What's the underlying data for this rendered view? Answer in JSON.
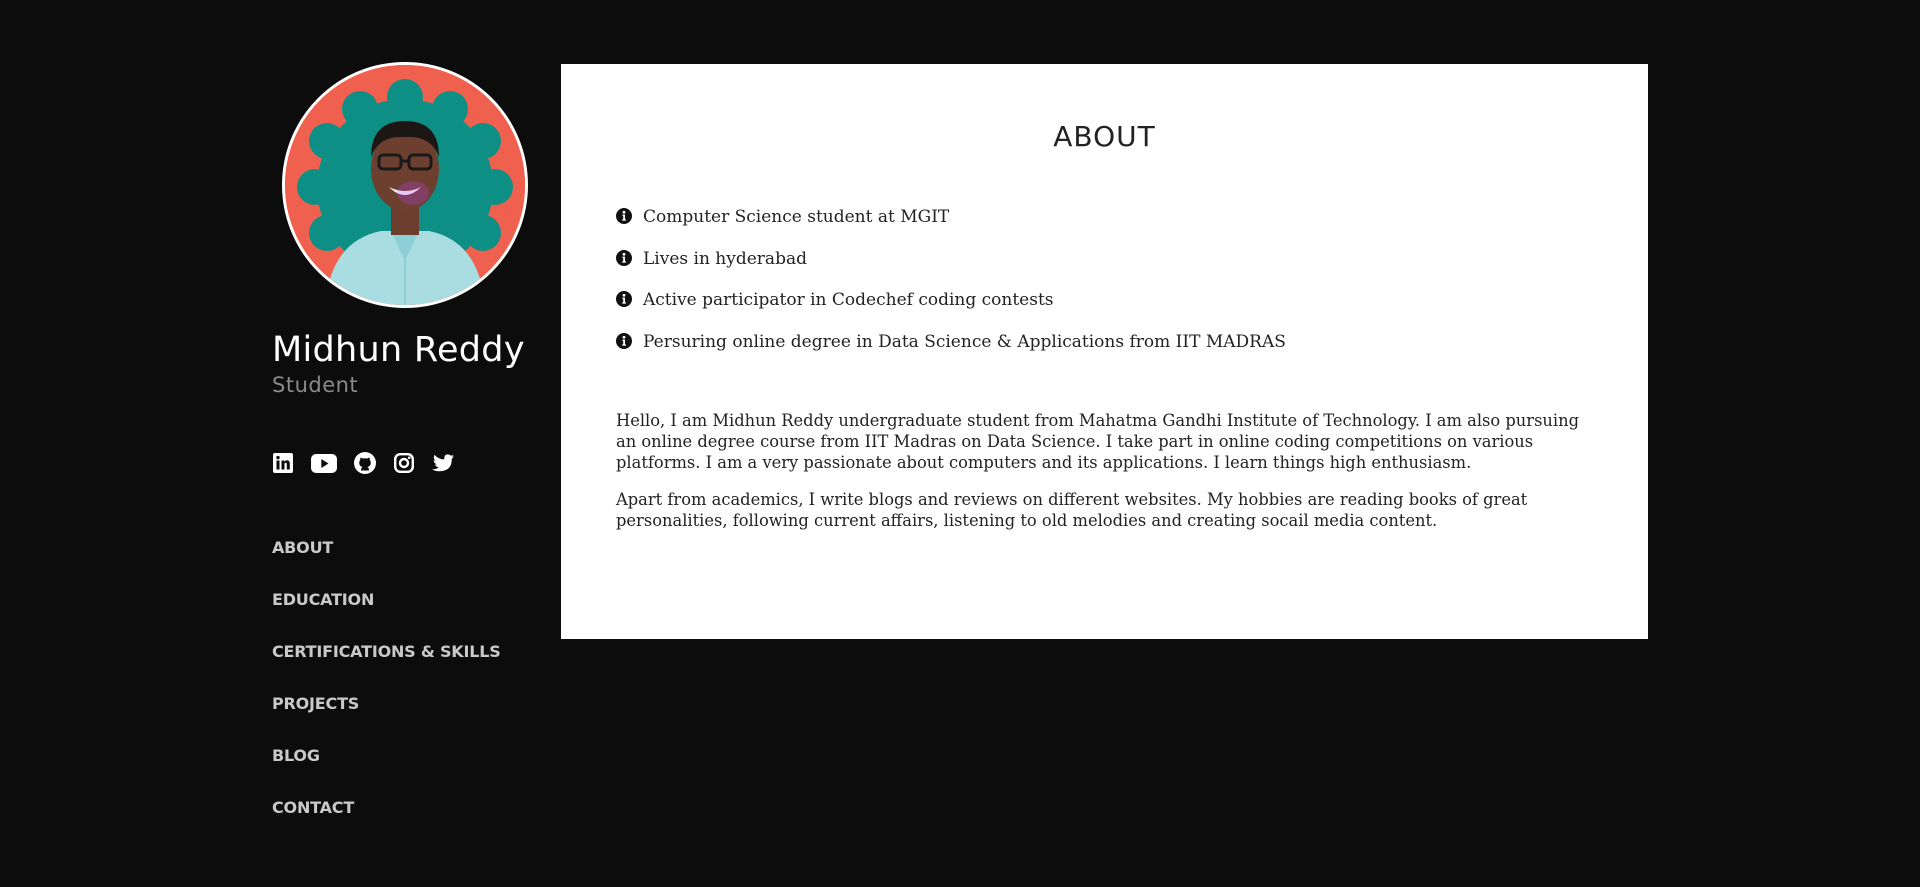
{
  "profile": {
    "name": "Midhun Reddy",
    "role": "Student"
  },
  "socials": [
    {
      "icon": "linkedin-icon"
    },
    {
      "icon": "youtube-icon"
    },
    {
      "icon": "github-icon"
    },
    {
      "icon": "instagram-icon"
    },
    {
      "icon": "twitter-icon"
    }
  ],
  "nav": {
    "items": [
      {
        "label": "ABOUT"
      },
      {
        "label": "EDUCATION"
      },
      {
        "label": "CERTIFICATIONS & SKILLS"
      },
      {
        "label": "PROJECTS"
      },
      {
        "label": "BLOG"
      },
      {
        "label": "CONTACT"
      }
    ]
  },
  "about": {
    "title": "ABOUT",
    "facts": [
      {
        "icon": "info-circle-icon",
        "text": "Computer Science student at MGIT"
      },
      {
        "icon": "info-circle-icon",
        "text": "Lives in hyderabad"
      },
      {
        "icon": "info-circle-icon",
        "text": "Active participator in Codechef coding contests"
      },
      {
        "icon": "info-circle-icon",
        "text": "Persuring online degree in Data Science & Applications from IIT MADRAS"
      }
    ],
    "paragraphs": [
      "Hello, I am Midhun Reddy undergraduate student from Mahatma Gandhi Institute of Technology. I am also pursuing an online degree course from IIT Madras on Data Science. I take part in online coding competitions on various platforms. I am a very passionate about computers and its applications. I learn things high enthusiasm.",
      "Apart from academics, I write blogs and reviews on different websites. My hobbies are reading books of great personalities, following current affairs, listening to old melodies and creating socail media content."
    ]
  },
  "colors": {
    "page_background": "#0c0c0c",
    "card_background": "#ffffff",
    "nav_text": "#c9c9c9",
    "role_text": "#8a8a8a",
    "avatar_background": "#f0604e",
    "avatar_inner": "#0e8f86"
  }
}
